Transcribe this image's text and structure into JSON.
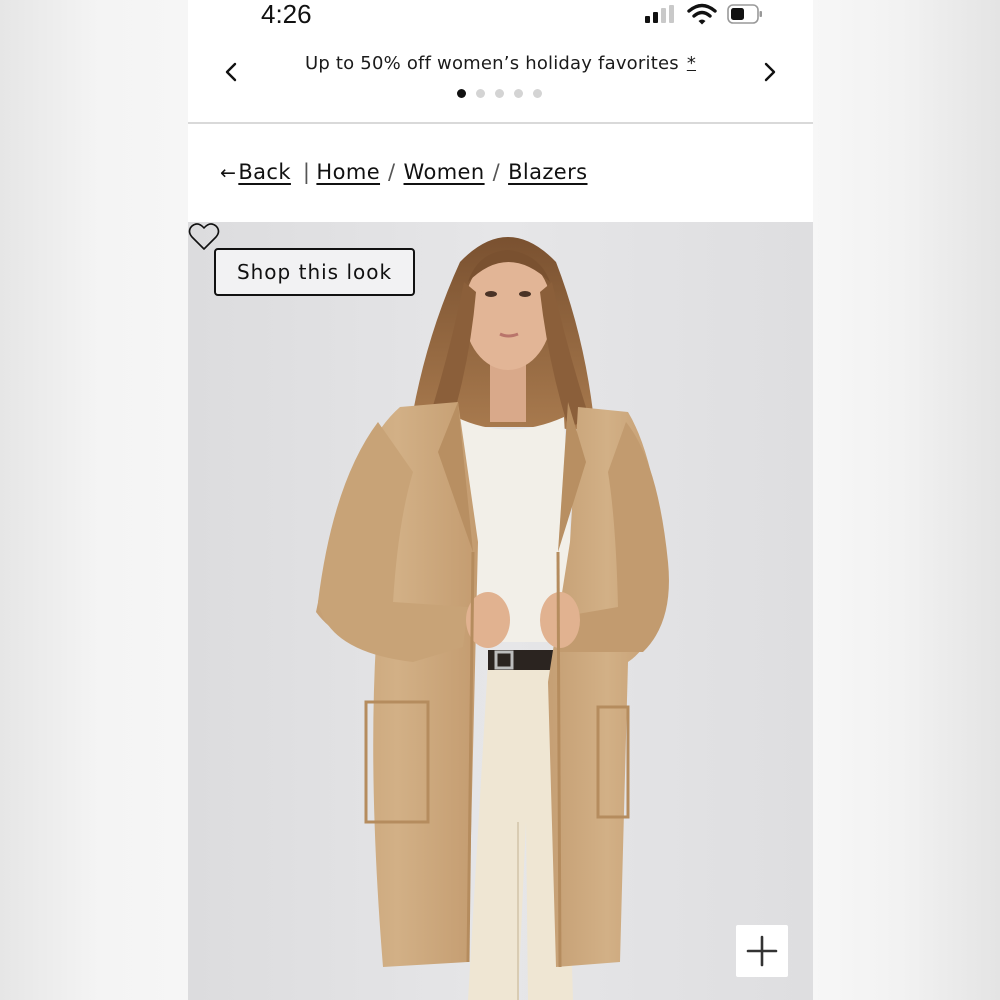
{
  "status_bar": {
    "time": "4:26",
    "signal_icon": "cellular-signal-icon",
    "wifi_icon": "wifi-icon",
    "battery_icon": "battery-icon",
    "battery_level": 0.5
  },
  "promo": {
    "text": "Up to 50% off women’s holiday favorites",
    "asterisk": "*",
    "prev_icon": "chevron-left-icon",
    "next_icon": "chevron-right-icon",
    "slides": 5,
    "active_slide": 1
  },
  "breadcrumb": {
    "back_arrow": "←",
    "back_label": "Back",
    "divider": "|",
    "items": [
      "Home",
      "Women",
      "Blazers"
    ],
    "separator": "/"
  },
  "hero": {
    "image": "model-wearing-camel-long-cardigan",
    "shop_look_label": "Shop this look",
    "favorite_icon": "heart-outline-icon",
    "zoom_icon": "plus-icon"
  },
  "colors": {
    "text": "#111111",
    "page_bg": "#ffffff",
    "hero_bg": "#e3e3e5",
    "coat": "#c9a67d",
    "shirt": "#f2efe8",
    "pants": "#efe6d3",
    "hair": "#8b5f3a",
    "divider": "#d9d9d9"
  }
}
